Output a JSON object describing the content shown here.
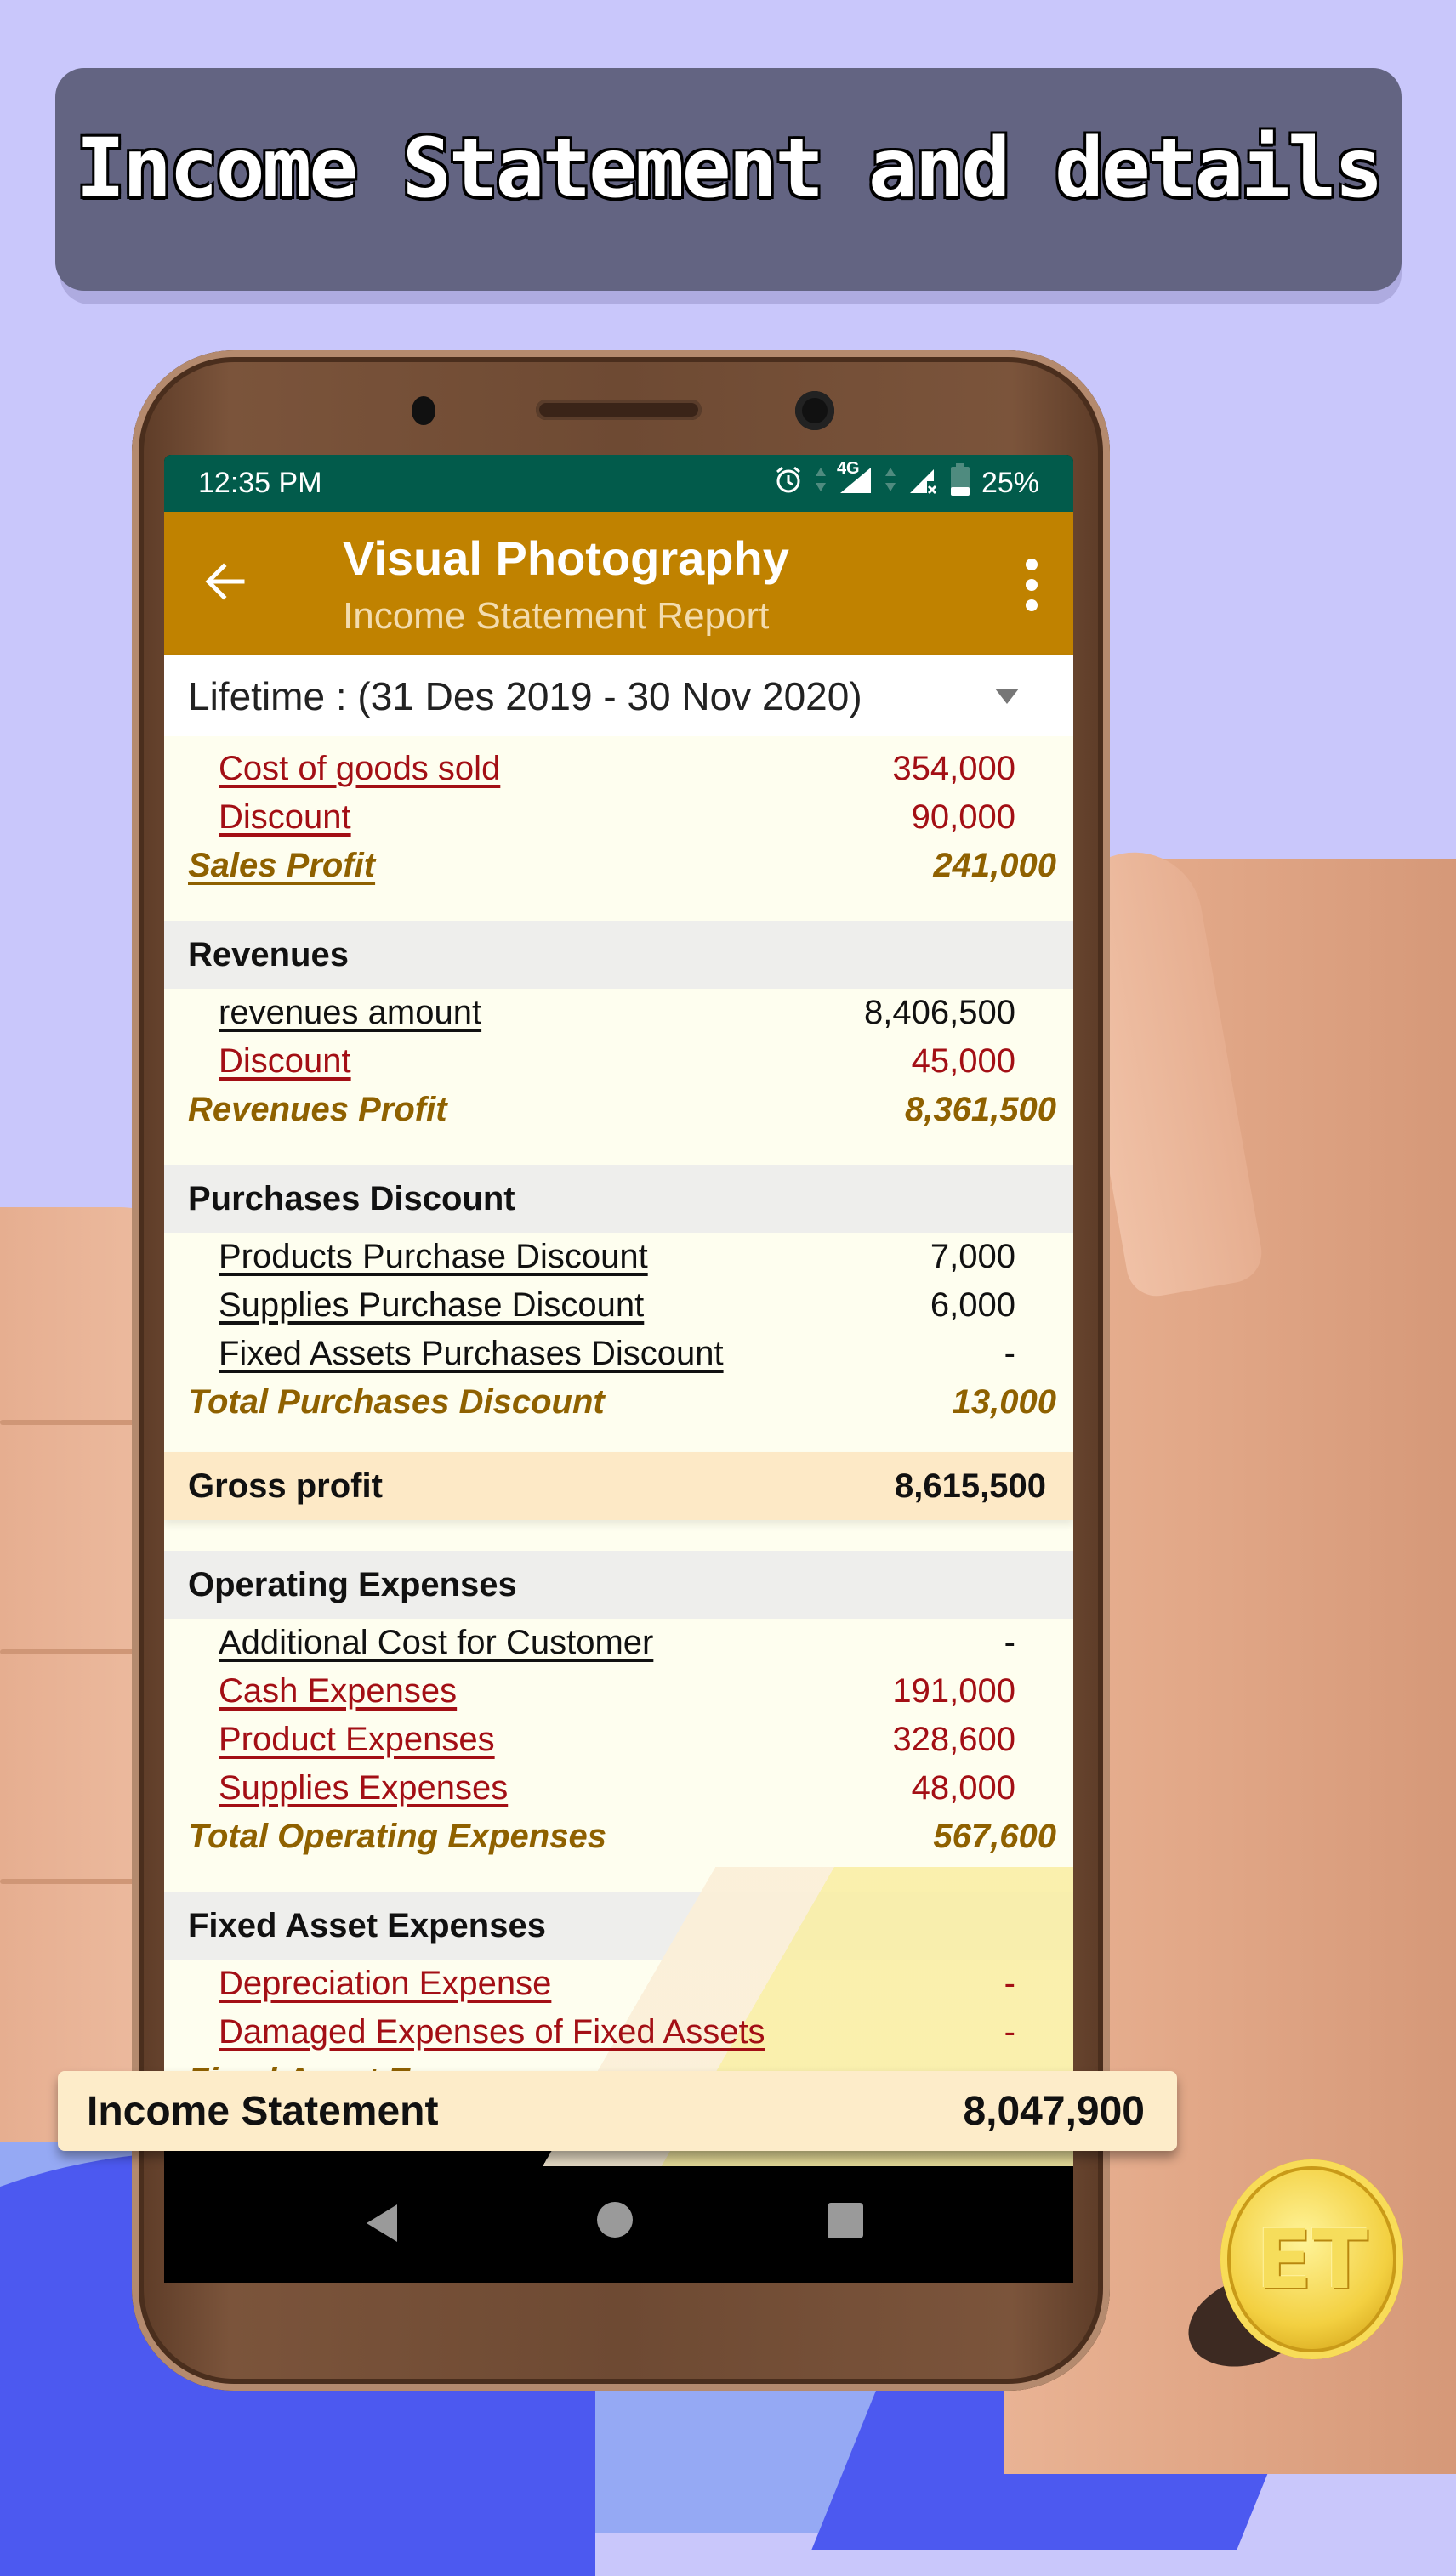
{
  "banner": {
    "title": "Income Statement and details"
  },
  "status_bar": {
    "time": "12:35 PM",
    "icons": [
      "alarm-icon",
      "data-arrows-icon",
      "4g-signal-icon",
      "no-sim-signal-icon",
      "battery-icon"
    ],
    "network_label": "4G",
    "battery": "25%"
  },
  "app_bar": {
    "title": "Visual Photography",
    "subtitle": "Income Statement Report",
    "back_icon": "arrow-left-icon",
    "menu_icon": "more-vert-icon"
  },
  "period": {
    "label": "Lifetime : (31 Des 2019 - 30 Nov 2020)",
    "dropdown_icon": "triangle-down-icon"
  },
  "sales": {
    "items": [
      {
        "label": "Cost of goods sold",
        "value": "354,000"
      },
      {
        "label": "Discount",
        "value": "90,000"
      }
    ],
    "total": {
      "label": "Sales Profit",
      "value": "241,000"
    }
  },
  "revenues": {
    "header": "Revenues",
    "items": [
      {
        "label": "revenues amount",
        "value": "8,406,500"
      },
      {
        "label": "Discount",
        "value": "45,000"
      }
    ],
    "total": {
      "label": "Revenues Profit",
      "value": "8,361,500"
    }
  },
  "purchases_discount": {
    "header": "Purchases Discount",
    "items": [
      {
        "label": "Products Purchase Discount",
        "value": "7,000"
      },
      {
        "label": "Supplies Purchase Discount",
        "value": "6,000"
      },
      {
        "label": "Fixed Assets Purchases Discount",
        "value": "-"
      }
    ],
    "total": {
      "label": "Total Purchases Discount",
      "value": "13,000"
    }
  },
  "gross_profit": {
    "label": "Gross profit",
    "value": "8,615,500"
  },
  "operating_expenses": {
    "header": "Operating Expenses",
    "items": [
      {
        "label": "Additional Cost for Customer",
        "value": "-"
      },
      {
        "label": "Cash Expenses",
        "value": "191,000"
      },
      {
        "label": "Product Expenses",
        "value": "328,600"
      },
      {
        "label": "Supplies Expenses",
        "value": "48,000"
      }
    ],
    "total": {
      "label": "Total Operating Expenses",
      "value": "567,600"
    }
  },
  "fixed_asset_expenses": {
    "header": "Fixed Asset Expenses",
    "items": [
      {
        "label": "Depreciation Expense",
        "value": "-"
      },
      {
        "label": "Damaged Expenses of Fixed Assets",
        "value": "-"
      }
    ],
    "total": {
      "label": "Fixed Asset Expenses",
      "value": "-"
    }
  },
  "income_statement": {
    "label": "Income Statement",
    "value": "8,047,900"
  },
  "nav_bar": {
    "icons": [
      "nav-back-icon",
      "nav-home-icon",
      "nav-recents-icon"
    ]
  },
  "logo": {
    "text": "ET"
  },
  "colors": {
    "status_bar": "#025b4b",
    "app_bar": "#c08200",
    "expense_red": "#a30f15",
    "total_gold": "#8f6100",
    "section_header": "#eeeeec",
    "highlight_row": "#fde9c6",
    "row_background": "#fefeef"
  }
}
